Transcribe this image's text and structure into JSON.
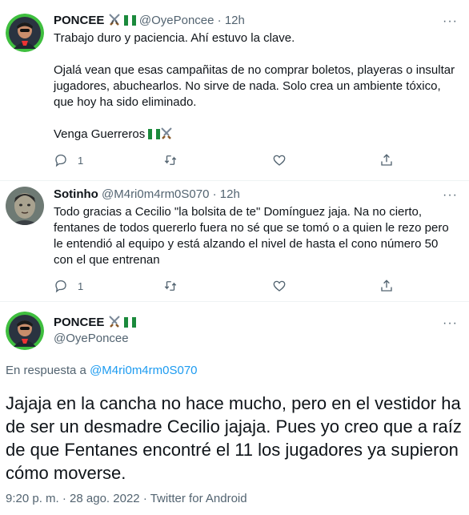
{
  "tweet1": {
    "name": "PONCEE",
    "handle": "@OyePoncee",
    "time": "12h",
    "lines": [
      "Trabajo duro y paciencia. Ahí estuvo la clave.",
      "Ojalá vean que esas campañitas de no comprar boletos, playeras o insultar jugadores, abuchearlos. No sirve de nada. Solo crea un ambiente tóxico, que hoy ha sido eliminado.",
      "Venga Guerreros"
    ],
    "reply_count": "1"
  },
  "tweet2": {
    "name": "Sotinho",
    "handle": "@M4ri0m4rm0S070",
    "time": "12h",
    "text": "Todo gracias a Cecilio \"la bolsita de te\" Domínguez jaja. Na no cierto, fentanes de todos quererlo fuera no sé que se tomó o a quien le rezo pero le entendió al equipo y está alzando el nivel de hasta el cono número 50 con el que entrenan",
    "reply_count": "1"
  },
  "tweet3": {
    "name": "PONCEE",
    "handle": "@OyePoncee",
    "reply_prefix": "En respuesta a",
    "reply_handle": "@M4ri0m4rm0S070",
    "text": "Jajaja en la cancha no hace mucho, pero en el vestidor ha de ser un desmadre Cecilio jajaja. Pues yo creo que a raíz de que Fentanes encontré el 11 los jugadores ya supieron cómo moverse.",
    "time_full": "9:20 p. m.",
    "date": "28 ago. 2022",
    "source": "Twitter for Android"
  },
  "ui": {
    "separator": "·",
    "more": "···"
  },
  "colors": {
    "accent": "#1d9bf0",
    "muted": "#536471",
    "text": "#0f1419",
    "avatar_ring": "#3fbf3f"
  },
  "icons": [
    "reply-icon",
    "retweet-icon",
    "like-icon",
    "share-icon",
    "more-icon",
    "crossed-swords-icon",
    "mexico-flag-icon"
  ]
}
